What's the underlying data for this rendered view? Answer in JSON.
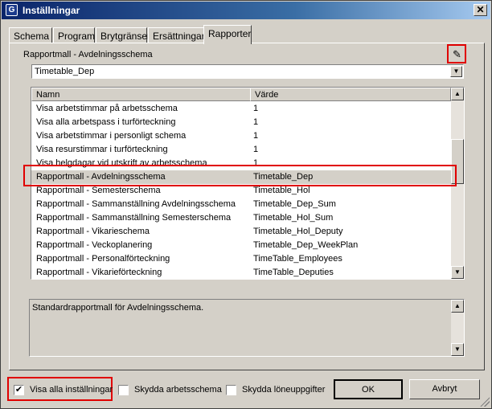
{
  "window": {
    "title": "Inställningar",
    "close": "✕"
  },
  "tabs": [
    "Schema",
    "Program",
    "Brytgränser",
    "Ersättningar",
    "Rapporter"
  ],
  "active_tab": "Rapporter",
  "section_label": "Rapportmall - Avdelningsschema",
  "combo": {
    "value": "Timetable_Dep"
  },
  "table": {
    "headers": {
      "name": "Namn",
      "value": "Värde"
    },
    "rows": [
      {
        "name": "Visa arbetstimmar på arbetsschema",
        "value": "1"
      },
      {
        "name": "Visa alla arbetspass i turförteckning",
        "value": "1"
      },
      {
        "name": "Visa arbetstimmar i personligt schema",
        "value": "1"
      },
      {
        "name": "Visa resurstimmar i turförteckning",
        "value": "1"
      },
      {
        "name": "Visa helgdagar vid utskrift av arbetsschema",
        "value": "1"
      },
      {
        "name": "Rapportmall - Avdelningsschema",
        "value": "Timetable_Dep"
      },
      {
        "name": "Rapportmall - Semesterschema",
        "value": "Timetable_Hol"
      },
      {
        "name": "Rapportmall - Sammanställning Avdelningsschema",
        "value": "Timetable_Dep_Sum"
      },
      {
        "name": "Rapportmall - Sammanställning Semesterschema",
        "value": "Timetable_Hol_Sum"
      },
      {
        "name": "Rapportmall - Vikarieschema",
        "value": "Timetable_Hol_Deputy"
      },
      {
        "name": "Rapportmall - Veckoplanering",
        "value": "Timetable_Dep_WeekPlan"
      },
      {
        "name": "Rapportmall - Personalförteckning",
        "value": "TimeTable_Employees"
      },
      {
        "name": "Rapportmall - Vikarieförteckning",
        "value": "TimeTable_Deputies"
      }
    ],
    "selected_row": "Rapportmall - Avdelningsschema"
  },
  "description": "Standardrapportmall för Avdelningsschema.",
  "checkboxes": [
    {
      "label": "Visa alla inställningar",
      "checked": true
    },
    {
      "label": "Skydda arbetsschema",
      "checked": false
    },
    {
      "label": "Skydda löneuppgifter",
      "checked": false
    }
  ],
  "buttons": {
    "ok": "OK",
    "cancel": "Avbryt"
  },
  "icons": {
    "title": "app-icon",
    "edit": "pencil-icon",
    "combo_arrow": "chevron-down-icon"
  },
  "colors": {
    "highlight": "#e00000",
    "titlebar": "#0a246a"
  }
}
